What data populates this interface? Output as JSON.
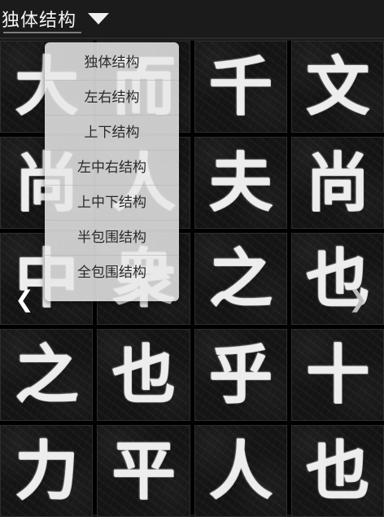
{
  "header": {
    "title": "独体结构"
  },
  "menu": {
    "items": [
      "独体结构",
      "左右结构",
      "上下结构",
      "左中右结构",
      "上中下结构",
      "半包围结构",
      "全包围结构"
    ]
  },
  "grid": {
    "cells": [
      "大",
      "而",
      "千",
      "文",
      "尚",
      "人",
      "夫",
      "尚",
      "中",
      "衆",
      "之",
      "也",
      "之",
      "也",
      "乎",
      "十",
      "力",
      "平",
      "人",
      "也"
    ]
  },
  "icons": {
    "dropdown": "chevron-down-icon",
    "prev": "chevron-left-icon",
    "next": "chevron-right-icon"
  },
  "colors": {
    "background": "#1a1a1a",
    "menu_background": "#e8e8e8",
    "text_light": "#f4f4f4"
  }
}
